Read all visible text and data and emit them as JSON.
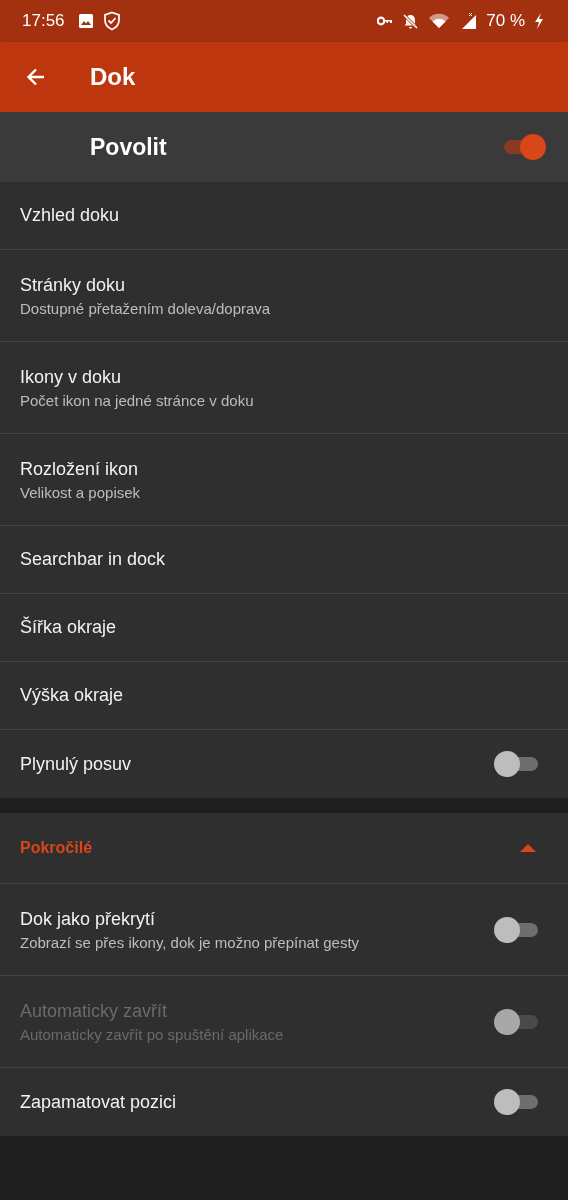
{
  "status_bar": {
    "time": "17:56",
    "battery": "70 %"
  },
  "app_bar": {
    "title": "Dok"
  },
  "master_switch": {
    "label": "Povolit",
    "on": true
  },
  "items": [
    {
      "kind": "nav",
      "title": "Vzhled doku"
    },
    {
      "kind": "nav",
      "title": "Stránky doku",
      "subtitle": "Dostupné přetažením doleva/doprava"
    },
    {
      "kind": "nav",
      "title": "Ikony v doku",
      "subtitle": "Počet ikon na jedné stránce v doku"
    },
    {
      "kind": "nav",
      "title": "Rozložení ikon",
      "subtitle": "Velikost a popisek"
    },
    {
      "kind": "nav",
      "title": "Searchbar in dock"
    },
    {
      "kind": "nav",
      "title": "Šířka okraje"
    },
    {
      "kind": "nav",
      "title": "Výška okraje"
    },
    {
      "kind": "switch",
      "title": "Plynulý posuv",
      "on": false,
      "disabled": false
    }
  ],
  "advanced": {
    "title": "Pokročilé",
    "expanded": true,
    "items": [
      {
        "kind": "switch",
        "title": "Dok jako překrytí",
        "subtitle": "Zobrazí se přes ikony, dok je možno přepínat gesty",
        "on": false,
        "disabled": false
      },
      {
        "kind": "switch",
        "title": "Automaticky zavřít",
        "subtitle": "Automaticky zavřít po spuštění aplikace",
        "on": false,
        "disabled": true
      },
      {
        "kind": "switch",
        "title": "Zapamatovat pozici",
        "on": false,
        "disabled": false
      }
    ]
  }
}
